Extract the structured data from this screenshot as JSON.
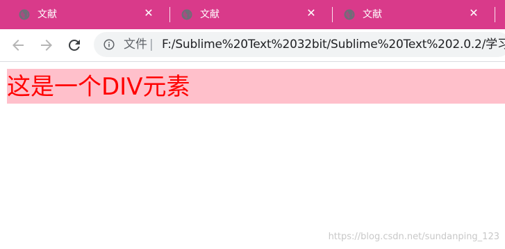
{
  "browser": {
    "tabs": [
      {
        "title": "文献",
        "close": "✕"
      },
      {
        "title": "文献",
        "close": "✕"
      },
      {
        "title": "文献",
        "close": "✕"
      }
    ],
    "colors": {
      "tabbar": "#d93a8a",
      "omnibox": "#f1f3f4"
    },
    "address": {
      "scheme_label": "文件",
      "divider": "|",
      "url": "F:/Sublime%20Text%2032bit/Sublime%20Text%202.0.2/学习"
    },
    "icons": {
      "back": "back-arrow-icon",
      "forward": "forward-arrow-icon",
      "reload": "reload-icon",
      "info": "info-icon",
      "tab": "globe-icon"
    }
  },
  "page": {
    "div_text": "这是一个DIV元素",
    "div_background": "#ffc0cb",
    "div_color": "#ff0000"
  },
  "watermark": "https://blog.csdn.net/sundanping_123"
}
